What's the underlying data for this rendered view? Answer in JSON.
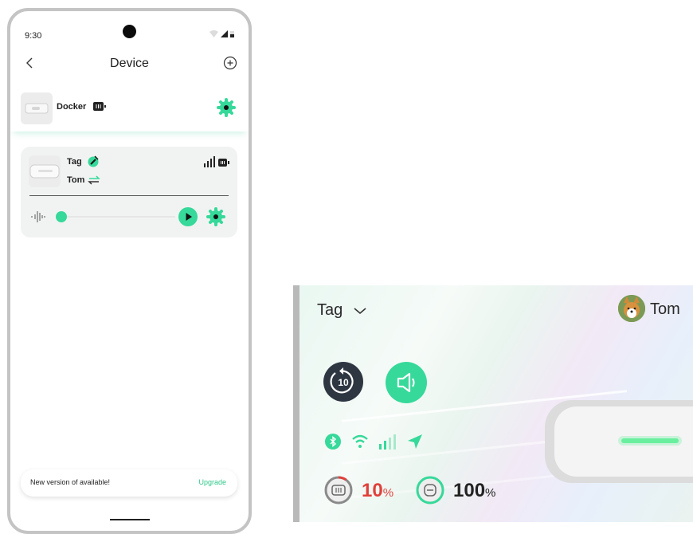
{
  "status_bar": {
    "time": "9:30"
  },
  "app_bar": {
    "title": "Device"
  },
  "docker": {
    "name": "Docker"
  },
  "tag_card": {
    "name": "Tag",
    "owner": "Tom",
    "playback_progress": 0
  },
  "update_banner": {
    "message": "New version of available!",
    "action": "Upgrade"
  },
  "detail": {
    "device_selector": "Tag",
    "user": "Tom",
    "replay_label": "10",
    "tag_battery": {
      "value": "10",
      "unit": "%",
      "fraction": 0.1
    },
    "dock_battery": {
      "value": "100",
      "unit": "%",
      "fraction": 1.0
    }
  },
  "colors": {
    "accent": "#36d99a",
    "dark_button": "#2e3642",
    "low_battery": "#e0403a"
  }
}
